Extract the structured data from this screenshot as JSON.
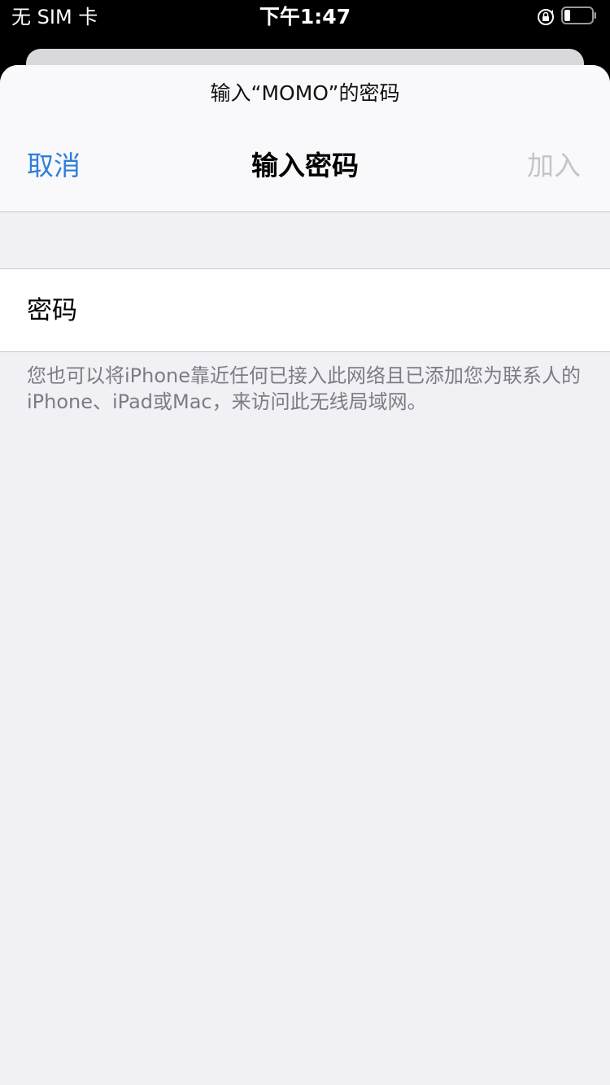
{
  "status_bar": {
    "carrier": "无 SIM 卡",
    "time": "下午1:47",
    "lock_icon": "rotation-lock-icon",
    "battery_icon": "battery-low-icon"
  },
  "sheet": {
    "prompt": "输入“MOMO”的密码",
    "nav": {
      "cancel_label": "取消",
      "title": "输入密码",
      "join_label": "加入"
    },
    "password_field": {
      "label": "密码",
      "value": ""
    },
    "footnote": "您也可以将iPhone靠近任何已接入此网络且已添加您为联系人的iPhone、iPad或Mac，来访问此无线局域网。"
  },
  "colors": {
    "accent": "#2f7fd9",
    "disabled": "#c4c4c9",
    "background": "#f1f1f5",
    "footnote": "#7c7c82"
  }
}
